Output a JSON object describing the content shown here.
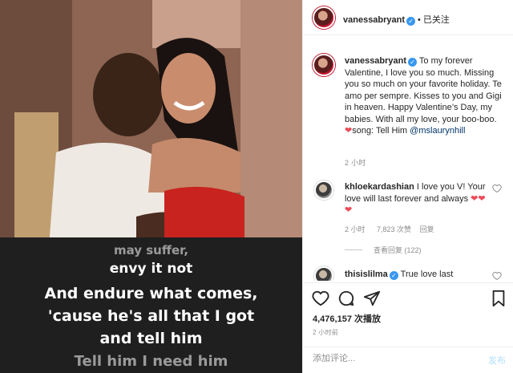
{
  "media": {
    "lyrics": {
      "partial_line": "may suffer,",
      "line1": "envy it not",
      "line2": "And endure what comes,",
      "line3": "'cause he's all that I got",
      "line4": "and tell him",
      "line5": "Tell him I need him"
    }
  },
  "header": {
    "username": "vanessabryant",
    "verified_mark": "✓",
    "separator": "•",
    "follow_status": "已关注",
    "more_icon": "more-icon"
  },
  "caption": {
    "username": "vanessabryant",
    "text_1": "To my forever Valentine, I love you so much. Missing you so much on your favorite holiday. Te amo per sempre. Kisses to you and Gigi in heaven. Happy Valentine’s Day, my babies. With all my love, your boo-boo. ",
    "heart": "❤",
    "text_2": "song: Tell Him",
    "mention": "@mslaurynhill",
    "time": "2 小时"
  },
  "comments": [
    {
      "username": "khloekardashian",
      "text": "I love you V! Your love will last forever and always ",
      "hearts": "❤❤❤",
      "time": "2 小时",
      "likes": "7,823 次赞",
      "reply": "回复",
      "view_replies": "查看回复 (122)"
    },
    {
      "username": "thisislilma",
      "text": "True love last"
    }
  ],
  "actions": {
    "icons": [
      "heart-icon",
      "comment-icon",
      "share-icon",
      "save-icon"
    ],
    "views": "4,476,157 次播放",
    "post_time": "2 小时前"
  },
  "add_comment": {
    "placeholder": "添加评论...",
    "post_label": "发布"
  },
  "colors": {
    "link": "#003569",
    "verified": "#3897f0",
    "heart": "#ed4956",
    "muted": "#8e8e8e",
    "post_disabled": "#b2dffc"
  }
}
